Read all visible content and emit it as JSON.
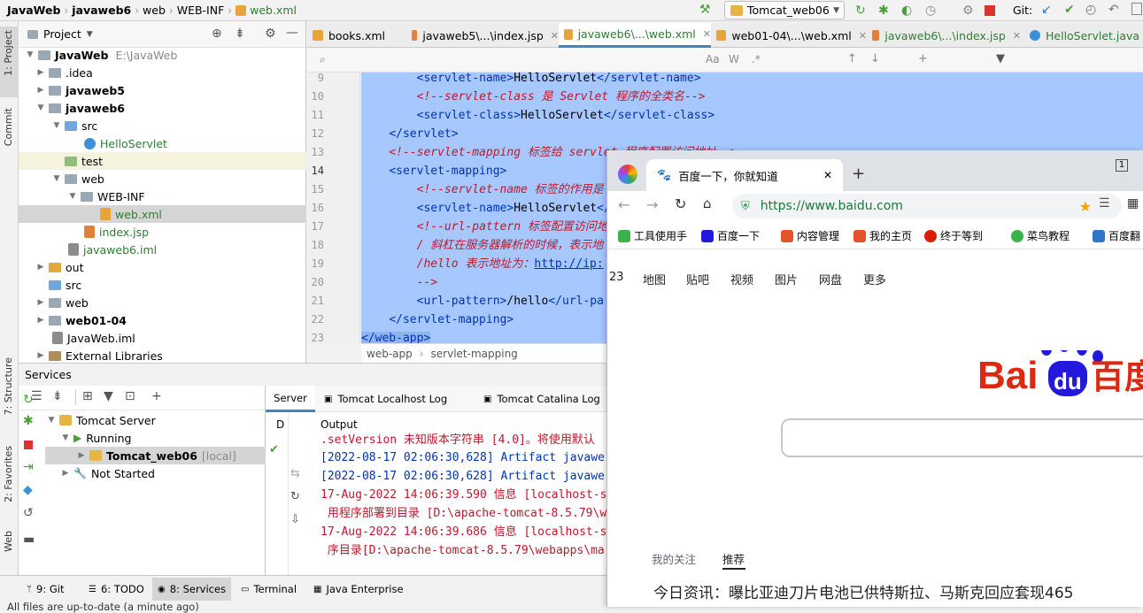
{
  "breadcrumb": [
    "JavaWeb",
    "javaweb6",
    "web",
    "WEB-INF",
    "web.xml"
  ],
  "run_config": "Tomcat_web06",
  "vcs_label": "Git:",
  "left_stripe": {
    "project": "1: Project",
    "commit": "Commit",
    "structure": "7: Structure",
    "favorites": "2: Favorites",
    "web": "Web"
  },
  "project_panel": {
    "title": "Project",
    "root_name": "JavaWeb",
    "root_path": "E:\\JavaWeb",
    "items": [
      {
        "label": "JavaWeb"
      },
      {
        "label": ".idea"
      },
      {
        "label": "javaweb5"
      },
      {
        "label": "javaweb6"
      },
      {
        "label": "src"
      },
      {
        "label": "HelloServlet"
      },
      {
        "label": "test"
      },
      {
        "label": "web"
      },
      {
        "label": "WEB-INF"
      },
      {
        "label": "web.xml"
      },
      {
        "label": "index.jsp"
      },
      {
        "label": "javaweb6.iml"
      },
      {
        "label": "out"
      },
      {
        "label": "src"
      },
      {
        "label": "web"
      },
      {
        "label": "web01-04"
      },
      {
        "label": "JavaWeb.iml"
      },
      {
        "label": "External Libraries"
      }
    ]
  },
  "editor_tabs": [
    "books.xml",
    "javaweb5\\...\\index.jsp",
    "javaweb6\\...\\web.xml",
    "web01-04\\...\\web.xml",
    "javaweb6\\...\\index.jsp",
    "HelloServlet.java"
  ],
  "code": {
    "line_numbers": [
      "9",
      "10",
      "11",
      "12",
      "13",
      "14",
      "15",
      "16",
      "17",
      "18",
      "19",
      "20",
      "21",
      "22",
      "23"
    ],
    "lines": [
      [
        "        ",
        "<servlet-name>",
        "HelloServlet",
        "</servlet-name>"
      ],
      [
        "        ",
        "<!--servlet-class 是 Servlet 程序的全类名-->"
      ],
      [
        "        ",
        "<servlet-class>",
        "HelloServlet",
        "</servlet-class>"
      ],
      [
        "    ",
        "</servlet>"
      ],
      [
        "    ",
        "<!--servlet-mapping 标签给 servlet 程序配置访问地址-->"
      ],
      [
        "    ",
        "<servlet-mapping>"
      ],
      [
        "        ",
        "<!--servlet-name 标签的作用是"
      ],
      [
        "        ",
        "<servlet-name>",
        "HelloServlet",
        "</"
      ],
      [
        "        ",
        "<!--url-pattern 标签配置访问地"
      ],
      [
        "        ",
        "/ 斜杠在服务器解析的时候，表示地"
      ],
      [
        "        ",
        "/hello 表示地址为：",
        "http://ip:"
      ],
      [
        "        ",
        "-->"
      ],
      [
        "        ",
        "<url-pattern>",
        "/hello",
        "</url-pa"
      ],
      [
        "    ",
        "</servlet-mapping>"
      ],
      [
        "",
        "</web-app>"
      ]
    ]
  },
  "editor_breadcrumb": [
    "web-app",
    "servlet-mapping"
  ],
  "services": {
    "title": "Services",
    "tree": [
      "Tomcat Server",
      "Running",
      "Tomcat_web06",
      "[local]",
      "Not Started"
    ],
    "tabs": [
      "Server",
      "Tomcat Localhost Log",
      "Tomcat Catalina Log"
    ],
    "col_d": "D",
    "output_label": "Output",
    "output_lines": [
      ".setVersion 未知版本字符串 [4.0]。将使用默认",
      "[2022-08-17 02:06:30,628] Artifact javawe",
      "[2022-08-17 02:06:30,628] Artifact javawe",
      "17-Aug-2022 14:06:39.590 信息 [localhost-s",
      " 用程序部署到目录 [D:\\apache-tomcat-8.5.79\\w",
      "17-Aug-2022 14:06:39.686 信息 [localhost-s",
      " 序目录[D:\\apache-tomcat-8.5.79\\webapps\\ma"
    ]
  },
  "bottom_tabs": [
    "9: Git",
    "6: TODO",
    "8: Services",
    "Terminal",
    "Java Enterprise"
  ],
  "status_text": "All files are up-to-date (a minute ago)",
  "browser": {
    "tab_title": "百度一下，你就知道",
    "url": "https://www.baidu.com",
    "counter": "1",
    "bookmarks": [
      "工具使用手",
      "百度一下",
      "内容管理",
      "我的主页",
      "终于等到",
      "菜鸟教程",
      "百度翻"
    ],
    "nav_links": [
      "23",
      "地图",
      "贴吧",
      "视频",
      "图片",
      "网盘",
      "更多"
    ],
    "logo_text_left": "Bai",
    "logo_text_du": "du",
    "logo_text_right": "百度",
    "feed_tabs": [
      "我的关注",
      "推荐"
    ],
    "news": "今日资讯：曝比亚迪刀片电池已供特斯拉、马斯克回应套现465"
  },
  "colors": {
    "selection": "#a6c8ff",
    "tag": "#0033b3",
    "comment": "#c0182b",
    "baidu_red": "#de2910",
    "baidu_blue": "#2319dc"
  }
}
